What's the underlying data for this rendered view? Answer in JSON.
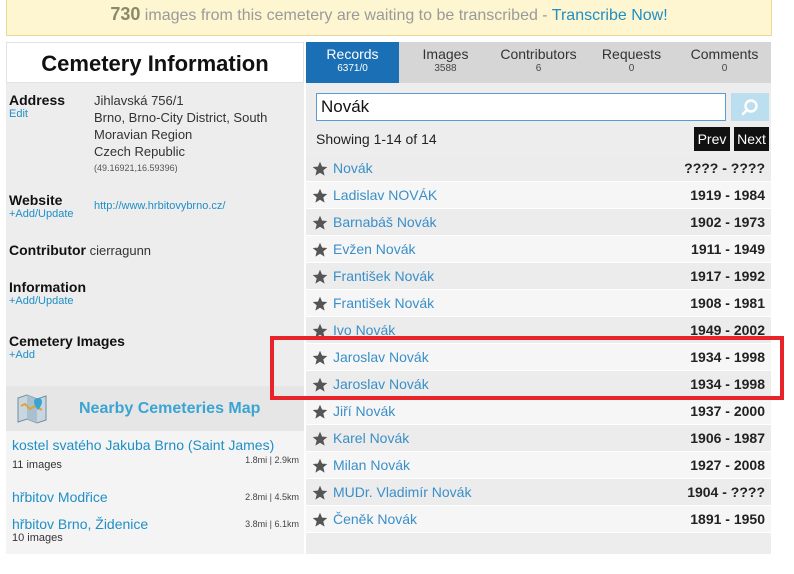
{
  "banner": {
    "count": "730",
    "text": " images from this cemetery are waiting to be transcribed - ",
    "link": "Transcribe Now!"
  },
  "left": {
    "title": "Cemetery Information",
    "address": {
      "label": "Address",
      "edit": "Edit",
      "line1": "Jihlavská 756/1",
      "line2": "Brno, Brno-City District, South",
      "line3": "Moravian Region",
      "line4": "Czech Republic",
      "coords": "(49.16921,16.59396)"
    },
    "website": {
      "label": "Website",
      "action": "+Add/Update",
      "url": "http://www.hrbitovybrno.cz/"
    },
    "contributor": {
      "label": "Contributor",
      "value": "cierragunn"
    },
    "information": {
      "label": "Information",
      "action": "+Add/Update"
    },
    "images": {
      "label": "Cemetery Images",
      "action": "+Add"
    }
  },
  "nearby": {
    "title": "Nearby Cemeteries Map",
    "items": [
      {
        "name": "kostel svatého Jakuba Brno (Saint James)",
        "distance": "1.8mi | 2.9km",
        "images": "11 images"
      },
      {
        "name": "hřbitov Modřice",
        "distance": "2.8mi | 4.5km",
        "images": ""
      },
      {
        "name": "hřbitov Brno, Židenice",
        "distance": "3.8mi | 6.1km",
        "images": "10 images"
      }
    ]
  },
  "tabs": [
    {
      "label": "Records",
      "count": "6371/0",
      "active": true
    },
    {
      "label": "Images",
      "count": "3588",
      "active": false
    },
    {
      "label": "Contributors",
      "count": "6",
      "active": false
    },
    {
      "label": "Requests",
      "count": "0",
      "active": false
    },
    {
      "label": "Comments",
      "count": "0",
      "active": false
    }
  ],
  "search": {
    "value": "Novák"
  },
  "results": {
    "showing": "Showing 1-14 of 14",
    "prev": "Prev",
    "next": "Next"
  },
  "records": [
    {
      "name": "Novák",
      "dates": "???? - ????"
    },
    {
      "name": "Ladislav NOVÁK",
      "dates": "1919 - 1984"
    },
    {
      "name": "Barnabáš Novák",
      "dates": "1902 - 1973"
    },
    {
      "name": "Evžen Novák",
      "dates": "1911 - 1949"
    },
    {
      "name": "František Novák",
      "dates": "1917 - 1992"
    },
    {
      "name": "František Novák",
      "dates": "1908 - 1981"
    },
    {
      "name": "Ivo Novák",
      "dates": "1949 - 2002"
    },
    {
      "name": "Jaroslav Novák",
      "dates": "1934 - 1998"
    },
    {
      "name": "Jaroslav Novák",
      "dates": "1934 - 1998"
    },
    {
      "name": "Jiří Novák",
      "dates": "1937 - 2000"
    },
    {
      "name": "Karel Novák",
      "dates": "1906 - 1987"
    },
    {
      "name": "Milan Novák",
      "dates": "1927 - 2008"
    },
    {
      "name": "MUDr. Vladimír Novák",
      "dates": "1904 - ????"
    },
    {
      "name": "Čeněk Novák",
      "dates": "1891 - 1950"
    }
  ],
  "colors": {
    "accent": "#1b6fb5",
    "link": "#1f8fc6",
    "highlight": "#e8232a",
    "banner_bg": "#fdf6d0"
  }
}
